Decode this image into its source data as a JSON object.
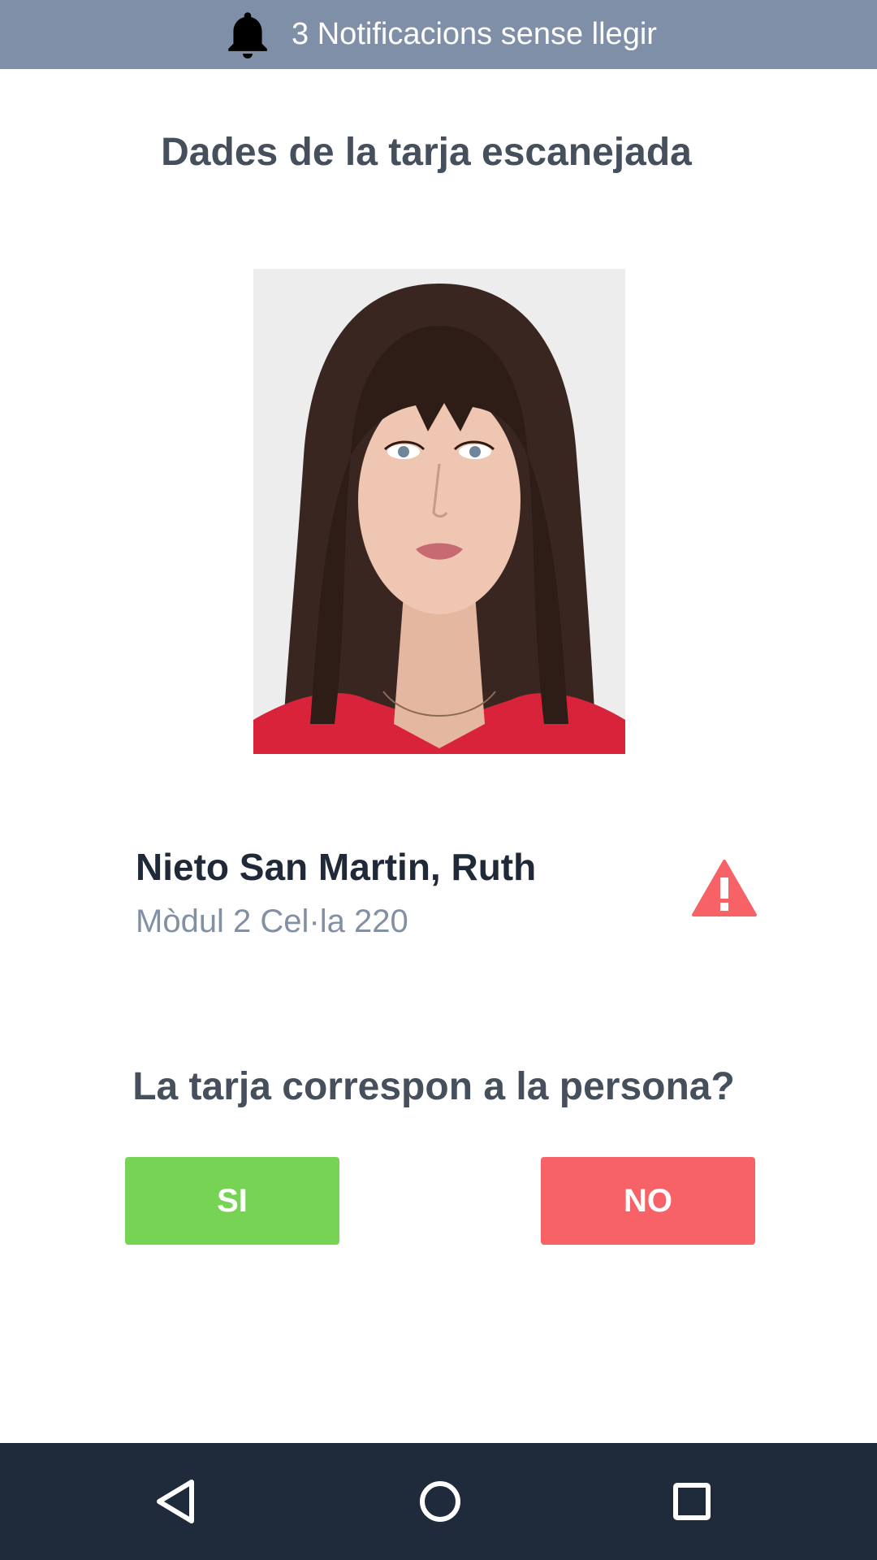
{
  "notification": {
    "icon": "bell-icon",
    "text": "3 Notificacions sense llegir",
    "background": "#808fa8"
  },
  "screen": {
    "title": "Dades de la tarja escanejada"
  },
  "person": {
    "photo": "portrait-photo",
    "name": "Nieto San Martin, Ruth",
    "location": "Mòdul 2 Cel·la 220",
    "alert_icon": "warning-icon",
    "alert_color": "#f76266"
  },
  "confirmation": {
    "question": "La tarja correspon a la persona?",
    "yes_label": "SI",
    "no_label": "NO",
    "yes_color": "#77d354",
    "no_color": "#f76266"
  },
  "navigation": {
    "back_icon": "back-triangle-icon",
    "home_icon": "home-circle-icon",
    "recents_icon": "recents-square-icon",
    "background": "#1f2a3b"
  }
}
